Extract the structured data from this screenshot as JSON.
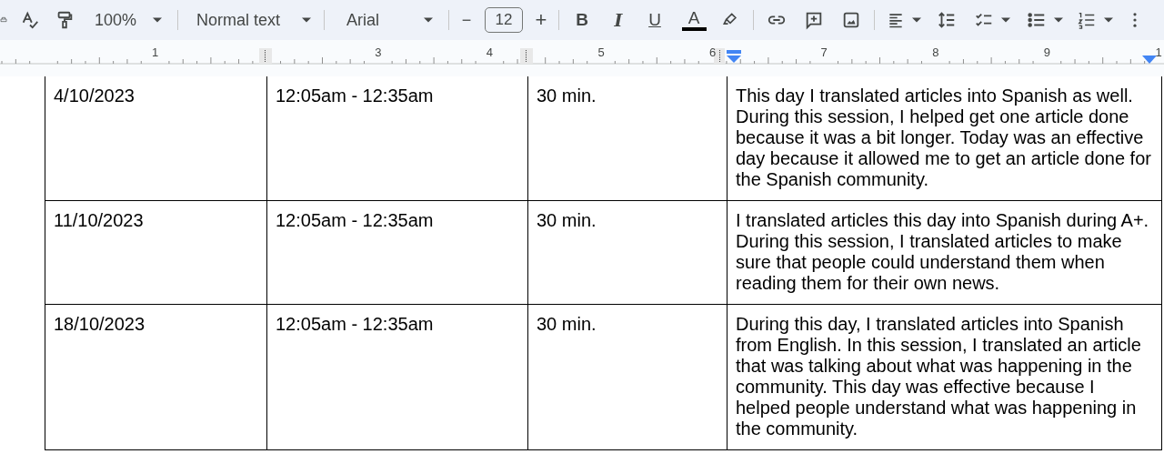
{
  "toolbar": {
    "zoom": "100%",
    "style": "Normal text",
    "font": "Arial",
    "font_size": "12",
    "minus": "−",
    "plus": "+",
    "format_buttons": [
      {
        "kind": "bold",
        "label": "B"
      },
      {
        "kind": "italic",
        "label": "I"
      },
      {
        "kind": "underline",
        "label": "U"
      },
      {
        "kind": "color",
        "label": "A"
      }
    ]
  },
  "ruler": {
    "numbers": [
      "1",
      "3",
      "4",
      "5",
      "6",
      "7",
      "8",
      "9",
      "1"
    ]
  },
  "table": {
    "rows": [
      {
        "date": "4/10/2023",
        "time": "12:05am - 12:35am",
        "duration": "30 min.",
        "description": "This day I translated articles into Spanish as well. During this session, I helped get one article done because it was a bit longer. Today was an effective day because it allowed me to get an article done for the Spanish community."
      },
      {
        "date": "11/10/2023",
        "time": "12:05am - 12:35am",
        "duration": "30 min.",
        "description": "I translated articles this day into Spanish during A+. During this session, I translated articles to make sure that people could understand them when reading them for their own news."
      },
      {
        "date": "18/10/2023",
        "time": "12:05am - 12:35am",
        "duration": "30 min.",
        "description": "During this day, I translated articles into Spanish from English. In this session, I translated an article that was talking about what was happening in the community. This day was effective because I helped people understand what was happening in the community."
      }
    ]
  }
}
